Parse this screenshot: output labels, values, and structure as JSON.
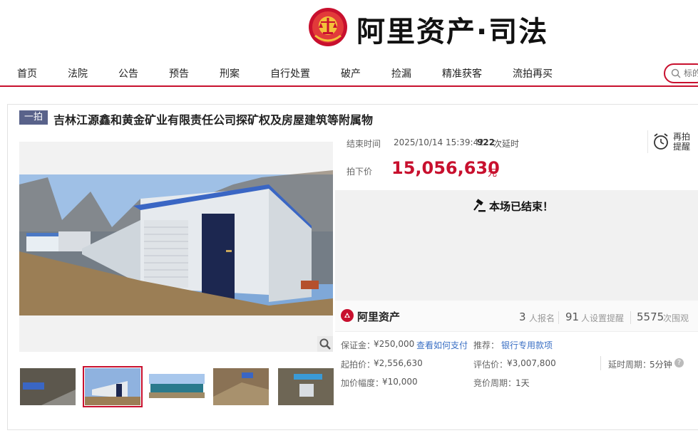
{
  "brand": {
    "logo_text": "阿里资产·司法"
  },
  "nav": {
    "items": [
      "首页",
      "法院",
      "公告",
      "预告",
      "刑案",
      "自行处置",
      "破产",
      "捡漏",
      "精准获客",
      "流拍再买"
    ]
  },
  "search": {
    "placeholder": "标的"
  },
  "item": {
    "round_badge": "一拍",
    "title": "吉林江源鑫和黄金矿业有限责任公司探矿权及房屋建筑等附属物",
    "end_time_label": "结束时间",
    "end_time": "2025/10/14 15:39:42",
    "delay_count": "922",
    "delay_label": "次延时",
    "price_label": "拍下价",
    "price": "15,056,630",
    "price_unit": "元",
    "reminder_label": "再拍提醒",
    "ended_text": "本场已结束！",
    "platform_logo_text": "阿里资产",
    "signups": "3",
    "signups_label": "人报名",
    "reminders": "91",
    "reminders_label": "人设置提醒",
    "views": "5575",
    "views_label": "次围观",
    "deposit_label": "保证金：",
    "deposit": "¥250,000",
    "pay_link": "查看如何支付",
    "recommend_label": "推荐：",
    "recommend_link": "银行专用款项",
    "start_price_label": "起拍价：",
    "start_price": "¥2,556,630",
    "appraisal_label": "评估价：",
    "appraisal": "¥3,007,800",
    "delay_period_label": "延时周期：",
    "delay_period": "5分钟",
    "increment_label": "加价幅度：",
    "increment": "¥10,000",
    "bid_cycle_label": "竞价周期：",
    "bid_cycle": "1天",
    "hint_glyph": "?"
  },
  "colors": {
    "accent": "#c8102e",
    "badge": "#59628a",
    "link": "#3a6fc4"
  }
}
